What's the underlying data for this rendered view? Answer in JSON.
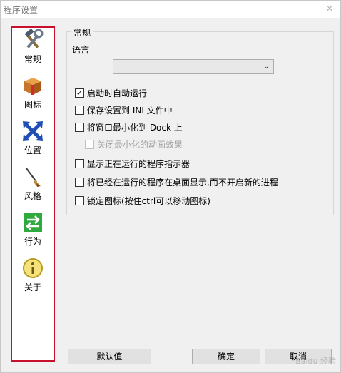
{
  "window": {
    "title": "程序设置",
    "close_glyph": "×"
  },
  "sidebar": {
    "items": [
      {
        "label": "常规",
        "icon": "tools-icon"
      },
      {
        "label": "图标",
        "icon": "box-icon"
      },
      {
        "label": "位置",
        "icon": "move-arrows-icon"
      },
      {
        "label": "风格",
        "icon": "brush-icon"
      },
      {
        "label": "行为",
        "icon": "swap-arrows-icon"
      },
      {
        "label": "关于",
        "icon": "info-icon"
      }
    ],
    "highlight_color": "#c8102e"
  },
  "general": {
    "group_title": "常规",
    "language_label": "语言",
    "language_value": "",
    "options": [
      {
        "label": "启动时自动运行",
        "checked": true,
        "disabled": false
      },
      {
        "label": "保存设置到 INI 文件中",
        "checked": false,
        "disabled": false
      },
      {
        "label": "将窗口最小化到 Dock 上",
        "checked": false,
        "disabled": false
      },
      {
        "label": "关闭最小化的动画效果",
        "checked": false,
        "disabled": true
      },
      {
        "label": "显示正在运行的程序指示器",
        "checked": false,
        "disabled": false
      },
      {
        "label": "将已经在运行的程序在桌面显示,而不开启新的进程",
        "checked": false,
        "disabled": false
      },
      {
        "label": "锁定图标(按住ctrl可以移动图标)",
        "checked": false,
        "disabled": false
      }
    ]
  },
  "buttons": {
    "default": "默认值",
    "ok": "确定",
    "cancel": "取消"
  },
  "watermark": "Baidu 经验"
}
